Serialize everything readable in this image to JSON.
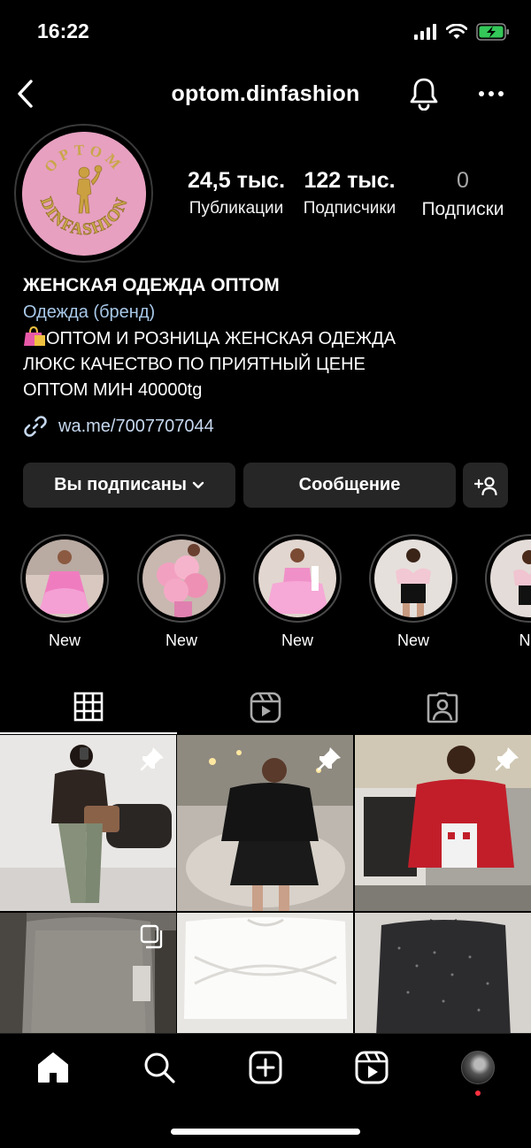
{
  "status_bar": {
    "time": "16:22",
    "icons": [
      "signal-icon",
      "wifi-icon",
      "battery-charging-icon"
    ]
  },
  "header": {
    "username": "optom.dinfashion",
    "icons": [
      "back-icon",
      "bell-icon",
      "more-icon"
    ]
  },
  "avatar": {
    "logo_text_top": "OPTOM",
    "logo_text_bottom": "DINFASHION",
    "colors": {
      "background": "#e7a0c0",
      "gold": "#c9a64a"
    }
  },
  "stats": {
    "posts": {
      "value": "24,5 тыс.",
      "label": "Публикации"
    },
    "followers": {
      "value": "122 тыс.",
      "label": "Подписчики"
    },
    "following": {
      "value": "0",
      "label": "Подписки"
    }
  },
  "bio": {
    "name": "ЖЕНСКАЯ ОДЕЖДА ОПТОМ",
    "category": "Одежда (бренд)",
    "line1": "ОПТОМ И РОЗНИЦА ЖЕНСКАЯ ОДЕЖДА",
    "line2": "ЛЮКС КАЧЕСТВО ПО ПРИЯТНЫЙ ЦЕНЕ",
    "line3": "ОПТОМ МИН 40000tg",
    "link": "wa.me/7007707044"
  },
  "buttons": {
    "following": "Вы подписаны",
    "message": "Сообщение"
  },
  "highlights": [
    {
      "label": "New"
    },
    {
      "label": "New"
    },
    {
      "label": "New"
    },
    {
      "label": "New"
    },
    {
      "label": "Ne"
    }
  ],
  "tabs": [
    "grid-icon",
    "reels-icon",
    "tagged-icon"
  ],
  "grid_posts": [
    {
      "pinned": true,
      "type": "photo"
    },
    {
      "pinned": true,
      "type": "photo"
    },
    {
      "pinned": true,
      "type": "photo"
    },
    {
      "pinned": false,
      "type": "carousel"
    },
    {
      "pinned": false,
      "type": "photo"
    },
    {
      "pinned": false,
      "type": "photo"
    }
  ],
  "bottom_nav": [
    "home-icon",
    "search-icon",
    "create-icon",
    "reels-icon",
    "profile-avatar"
  ],
  "theme": {
    "background": "#000000",
    "button": "#262626",
    "link": "#c6d8ef",
    "notification_dot": "#ff3040"
  }
}
